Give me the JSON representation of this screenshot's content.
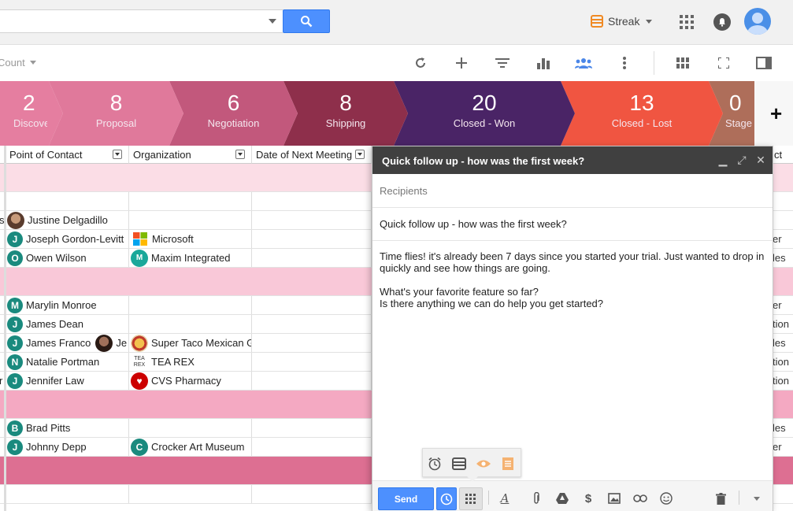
{
  "topbar": {
    "streak_label": "Streak",
    "icons": [
      "search-icon",
      "apps-grid-icon",
      "notifications-icon",
      "account-avatar"
    ]
  },
  "toolbar": {
    "sort_label": "Count",
    "icons": [
      "refresh-icon",
      "add-icon",
      "filter-icon",
      "chart-icon",
      "team-icon",
      "more-vert-icon",
      "grid-view-icon",
      "fullscreen-icon",
      "sidebar-icon"
    ]
  },
  "stages": [
    {
      "count": "2",
      "label": "Discovery",
      "color": "#e57ea0"
    },
    {
      "count": "8",
      "label": "Proposal",
      "color": "#e0799b"
    },
    {
      "count": "6",
      "label": "Negotiation",
      "color": "#c2587c"
    },
    {
      "count": "8",
      "label": "Shipping",
      "color": "#8e2f4b"
    },
    {
      "count": "20",
      "label": "Closed - Won",
      "color": "#4a2466"
    },
    {
      "count": "13",
      "label": "Closed - Lost",
      "color": "#f05541"
    },
    {
      "count": "0",
      "label": "Stage",
      "color": "#ae6e5a"
    }
  ],
  "add_stage": "+",
  "table": {
    "headers": [
      "Point of Contact",
      "Organization",
      "Date of Next Meeting",
      "ct"
    ],
    "rows": [
      {
        "type": "band",
        "color": "#fbdde6"
      },
      {
        "type": "row",
        "contact": "",
        "org": "",
        "right": ""
      },
      {
        "type": "row",
        "contact": "Justine Delgadillo",
        "badge": "",
        "photo": true,
        "org": "",
        "right": "",
        "left_clip": "s"
      },
      {
        "type": "row",
        "contact": "Joseph Gordon-Levitt",
        "badge": "J",
        "badge_color": "#1a8a7e",
        "org": "Microsoft",
        "org_icon": "microsoft-logo",
        "right": "er"
      },
      {
        "type": "row",
        "contact": "Owen Wilson",
        "badge": "O",
        "badge_color": "#1a8a7e",
        "org": "Maxim Integrated",
        "org_icon": "maxim-logo",
        "right": "les"
      },
      {
        "type": "band",
        "color": "#f9c8d8"
      },
      {
        "type": "row",
        "contact": "Marylin Monroe",
        "badge": "M",
        "badge_color": "#1a8a7e",
        "org": "",
        "right": "er"
      },
      {
        "type": "row",
        "contact": "James Dean",
        "badge": "J",
        "badge_color": "#1a8a7e",
        "org": "",
        "right": "tion"
      },
      {
        "type": "row",
        "contact": "James Franco",
        "badge": "J",
        "badge_color": "#1a8a7e",
        "org": "Super Taco Mexican Grill",
        "org_icon": "taco-logo",
        "right": "les",
        "extra": "Je"
      },
      {
        "type": "row",
        "contact": "Natalie Portman",
        "badge": "N",
        "badge_color": "#1a8a7e",
        "org": "TEA REX",
        "org_icon": "tearex-logo",
        "right": "tion"
      },
      {
        "type": "row",
        "contact": "Jennifer Law",
        "badge": "J",
        "badge_color": "#1a8a7e",
        "org": "CVS Pharmacy",
        "org_icon": "cvs-logo",
        "right": "tion",
        "left_clip": "r"
      },
      {
        "type": "band",
        "color": "#f4a9c2"
      },
      {
        "type": "row",
        "contact": "Brad Pitts",
        "badge": "B",
        "badge_color": "#1a8a7e",
        "org": "",
        "right": "les"
      },
      {
        "type": "row",
        "contact": "Johnny Depp",
        "badge": "J",
        "badge_color": "#1a8a7e",
        "org": "Crocker Art Museum",
        "org_icon": "crocker-logo",
        "org_badge": "C",
        "right": "er"
      },
      {
        "type": "band",
        "color": "#dd6f92"
      },
      {
        "type": "row",
        "contact": "",
        "org": "",
        "right": ""
      }
    ]
  },
  "compose": {
    "title": "Quick follow up - how was the first week?",
    "recipients_placeholder": "Recipients",
    "subject": "Quick follow up - how was the first week?",
    "body_lines": [
      "Time flies! it's already been 7 days since you started your trial. Just wanted to drop in quickly and see how things are going.",
      "",
      "What's your favorite feature so far?",
      "Is there anything we can do help you get started?"
    ],
    "send_label": "Send",
    "footer_icons": [
      "send-later-icon",
      "streak-tools-icon",
      "format-text-icon",
      "attach-icon",
      "drive-icon",
      "money-icon",
      "photo-icon",
      "link-icon",
      "emoji-icon",
      "trash-icon",
      "more-options-icon"
    ],
    "popup_icons": [
      "snooze-icon",
      "streak-box-icon",
      "tracking-eye-icon",
      "snippets-icon"
    ]
  }
}
